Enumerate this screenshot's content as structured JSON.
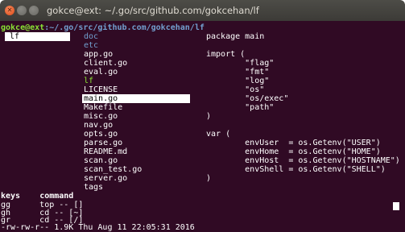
{
  "window": {
    "title": "gokce@ext: ~/.go/src/github.com/gokcehan/lf",
    "buttons": {
      "close": "✕",
      "minimize": "",
      "maximize": ""
    }
  },
  "prompt": {
    "user_host": "gokce@ext",
    "path": ":~/.go/src/github.com/gokcehan/lf"
  },
  "parent_pane": {
    "selected": "lf"
  },
  "files": [
    {
      "name": "doc",
      "kind": "dir"
    },
    {
      "name": "etc",
      "kind": "dir"
    },
    {
      "name": "app.go",
      "kind": "file"
    },
    {
      "name": "client.go",
      "kind": "file"
    },
    {
      "name": "eval.go",
      "kind": "file"
    },
    {
      "name": "lf",
      "kind": "exec"
    },
    {
      "name": "LICENSE",
      "kind": "file"
    },
    {
      "name": "main.go",
      "kind": "selected"
    },
    {
      "name": "Makefile",
      "kind": "file"
    },
    {
      "name": "misc.go",
      "kind": "file"
    },
    {
      "name": "nav.go",
      "kind": "file"
    },
    {
      "name": "opts.go",
      "kind": "file"
    },
    {
      "name": "parse.go",
      "kind": "file"
    },
    {
      "name": "README.md",
      "kind": "file"
    },
    {
      "name": "scan.go",
      "kind": "file"
    },
    {
      "name": "scan_test.go",
      "kind": "file"
    },
    {
      "name": "server.go",
      "kind": "file"
    },
    {
      "name": "tags",
      "kind": "file"
    }
  ],
  "preview": [
    "package main",
    "",
    "import (",
    "        \"flag\"",
    "        \"fmt\"",
    "        \"log\"",
    "        \"os\"",
    "        \"os/exec\"",
    "        \"path\"",
    ")",
    "",
    "var (",
    "        envUser  = os.Getenv(\"USER\")",
    "        envHome  = os.Getenv(\"HOME\")",
    "        envHost  = os.Getenv(\"HOSTNAME\")",
    "        envShell = os.Getenv(\"SHELL\")",
    ")"
  ],
  "keys_table": {
    "header_keys": "keys",
    "header_command": "command",
    "rows": [
      {
        "key": "gg",
        "command": "top -- []"
      },
      {
        "key": "gh",
        "command": "cd -- [~]"
      },
      {
        "key": "gr",
        "command": "cd -- [/]"
      }
    ]
  },
  "status_line": "-rw-rw-r-- 1.9K Thu Aug 11 22:05:31 2016"
}
